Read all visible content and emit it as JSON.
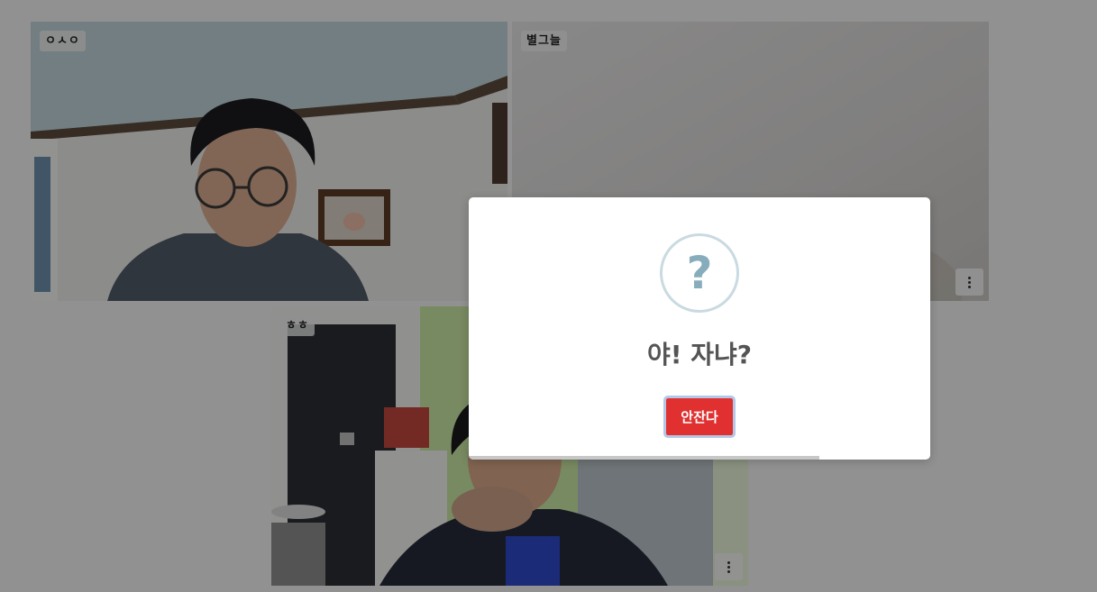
{
  "participants": [
    {
      "name": "ㅇㅅㅇ"
    },
    {
      "name": "별그늘"
    },
    {
      "name": "ㅎㅎ"
    }
  ],
  "dialog": {
    "icon": "question-icon",
    "icon_glyph": "?",
    "title": "야! 자냐?",
    "confirm_label": "안잔다",
    "timer_progress": 0.76
  },
  "colors": {
    "confirm_button": "#e03030",
    "question_icon": "#87adbd",
    "overlay": "rgba(0,0,0,0.4)"
  }
}
